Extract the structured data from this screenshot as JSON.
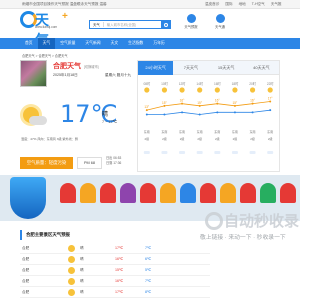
{
  "topbar": {
    "left": "雨烟市全国项目操作天气预报  温盘眼泳天气预报  温馨",
    "right": [
      "温皮首诊",
      "国际",
      "地地",
      "T-H空气",
      "天气推"
    ]
  },
  "logo": {
    "text": "天气",
    "plus": "+",
    "url": "www.tianqi.com"
  },
  "search": {
    "city": "天气",
    "placeholder": "输入城市名称(全国)"
  },
  "header_icons": [
    {
      "name": "weather-app-icon",
      "label": "天气预报"
    },
    {
      "name": "calendar-icon",
      "label": "天气通"
    }
  ],
  "nav": {
    "items": [
      "首页",
      "天气",
      "空气质量",
      "天气新闻",
      "天文",
      "生活指数",
      "万年历"
    ],
    "active": 1
  },
  "breadcrumb": "合肥天气 > 合肥天气 > 合肥天气",
  "city": {
    "name": "合肥天气",
    "switch": "[切换城市]",
    "date": "2025年1月18日",
    "lunar": "星期六  腊月十九"
  },
  "now": {
    "temp": "17℃",
    "cond": "晴",
    "range": "7 ~ 17℃",
    "info": "湿度：47%    风向：东南风 3级    紫外线：弱"
  },
  "aqi": {
    "label": "空气质量：轻度污染",
    "pm": "PM 68",
    "color": "#f39c12"
  },
  "sun": {
    "rise": "日出 06:53",
    "set": "日落 17:36"
  },
  "forecast": {
    "tabs": [
      "24小时天气",
      "7天天气",
      "15天天气",
      "40天天气"
    ],
    "active": 0
  },
  "chart_data": {
    "type": "line",
    "x": [
      "08时",
      "10时",
      "12时",
      "14时",
      "16时",
      "18时",
      "20时",
      "22时"
    ],
    "series": [
      {
        "values": [
          13,
          15,
          16,
          15,
          16,
          15,
          16,
          17
        ]
      },
      {
        "values": [
          11,
          11,
          12,
          11,
          12,
          12,
          12,
          13
        ]
      }
    ],
    "ylim": [
      8,
      20
    ],
    "title": "",
    "xlabel": "",
    "ylabel": ""
  },
  "forecast_labels": {
    "temps_high": [
      "13°",
      "15°",
      "16°",
      "15°",
      "16°",
      "15°",
      "16°",
      "17°"
    ],
    "winds": [
      "东南",
      "东南",
      "东南",
      "东南",
      "东南",
      "东南",
      "东南",
      "东南"
    ],
    "levels": [
      "2级",
      "2级",
      "2级",
      "2级",
      "2级",
      "2级",
      "2级",
      "2级"
    ]
  },
  "watermark": {
    "main": "自动秒收录",
    "sub": "敬上链接 · 来动一下 · 秒收录一下"
  },
  "tenday": {
    "title": "合肥主要景区天气预报",
    "rows": [
      {
        "place": "合肥",
        "weather": "晴",
        "high": "17℃",
        "low": "7℃"
      },
      {
        "place": "合肥",
        "weather": "晴",
        "high": "16℃",
        "low": "6℃"
      },
      {
        "place": "合肥",
        "weather": "晴",
        "high": "15℃",
        "low": "5℃"
      },
      {
        "place": "合肥",
        "weather": "晴",
        "high": "16℃",
        "low": "7℃"
      },
      {
        "place": "合肥",
        "weather": "晴",
        "high": "17℃",
        "low": "8℃"
      }
    ]
  }
}
